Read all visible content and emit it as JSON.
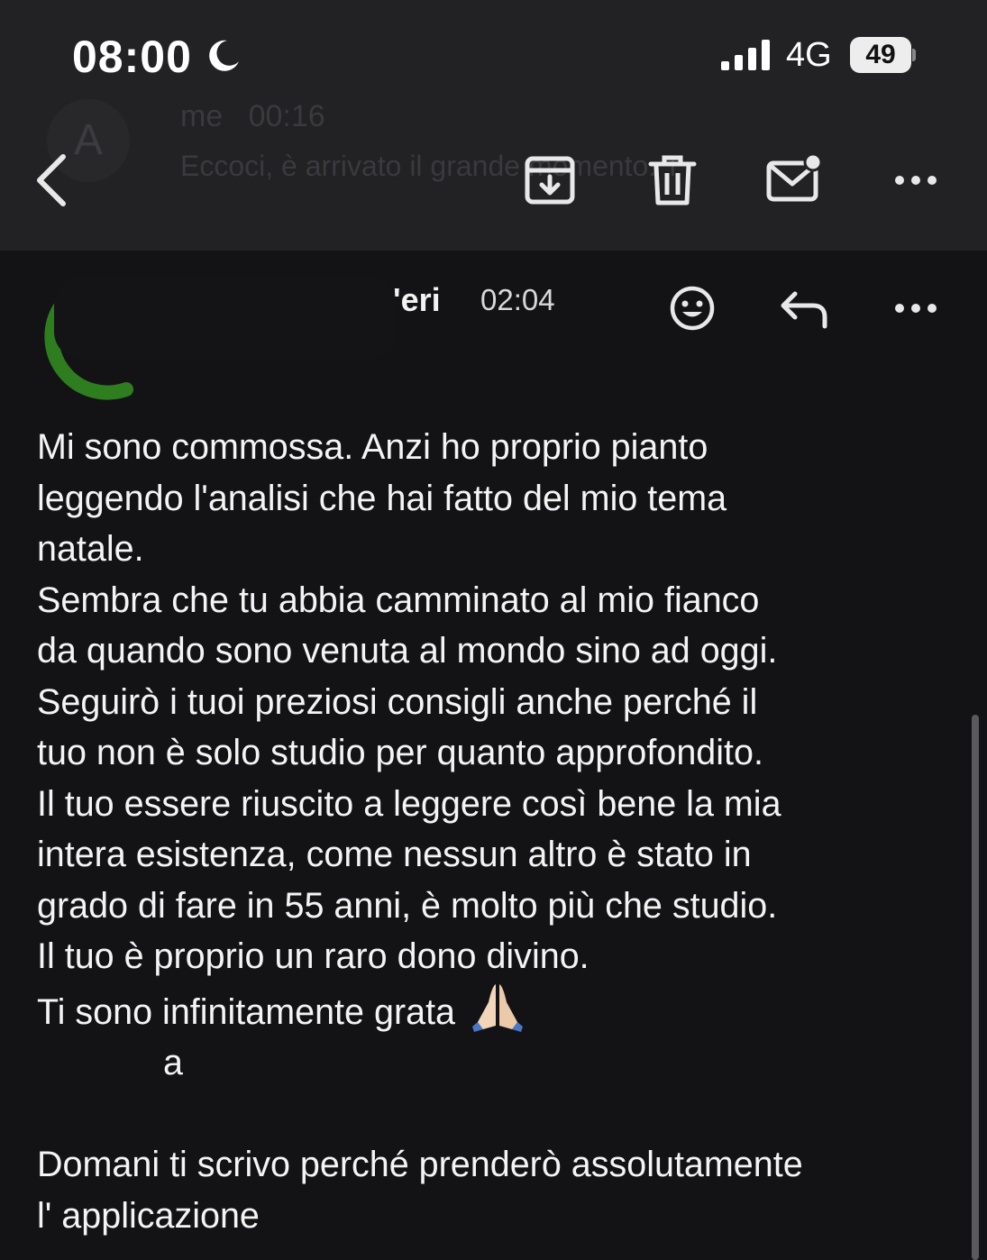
{
  "status_bar": {
    "time": "08:00",
    "network": "4G",
    "battery": "49",
    "icons": [
      "moon-icon",
      "signal-icon",
      "battery-icon"
    ]
  },
  "background_list": {
    "sender": "me",
    "time": "00:16",
    "avatar_letter": "A",
    "preview": "Eccoci, è arrivato il grande momento. T"
  },
  "toolbar": {
    "icons": [
      "back-icon",
      "archive-icon",
      "trash-icon",
      "mark-unread-icon",
      "more-icon"
    ]
  },
  "message": {
    "sender_name": "eri",
    "time": "02:04",
    "icons": [
      "emoji-reaction-icon",
      "reply-icon",
      "more-icon"
    ],
    "lines": [
      "Mi sono commossa. Anzi ho proprio pianto",
      "leggendo l'analisi che hai fatto del mio tema",
      "natale.",
      "Sembra che tu abbia camminato al mio fianco",
      "da quando sono venuta al mondo sino ad oggi.",
      "Seguirò i tuoi preziosi consigli anche perché il",
      "tuo non è solo studio per quanto approfondito.",
      "Il tuo essere riuscito a leggere così bene la mia",
      "intera esistenza, come nessun altro è stato in",
      "grado di fare in 55 anni, è molto più che studio.",
      "Il tuo è proprio un raro dono divino."
    ],
    "thanks_line": "Ti sono infinitamente grata",
    "signature_tail": "a",
    "closing_lines": [
      "Domani ti scrivo perché prenderò assolutamente",
      "l' applicazione"
    ]
  },
  "colors": {
    "topbar": "#222225",
    "background": "#131316",
    "text": "#f4f4f4",
    "avatar_ring": "#2e7d1f"
  }
}
